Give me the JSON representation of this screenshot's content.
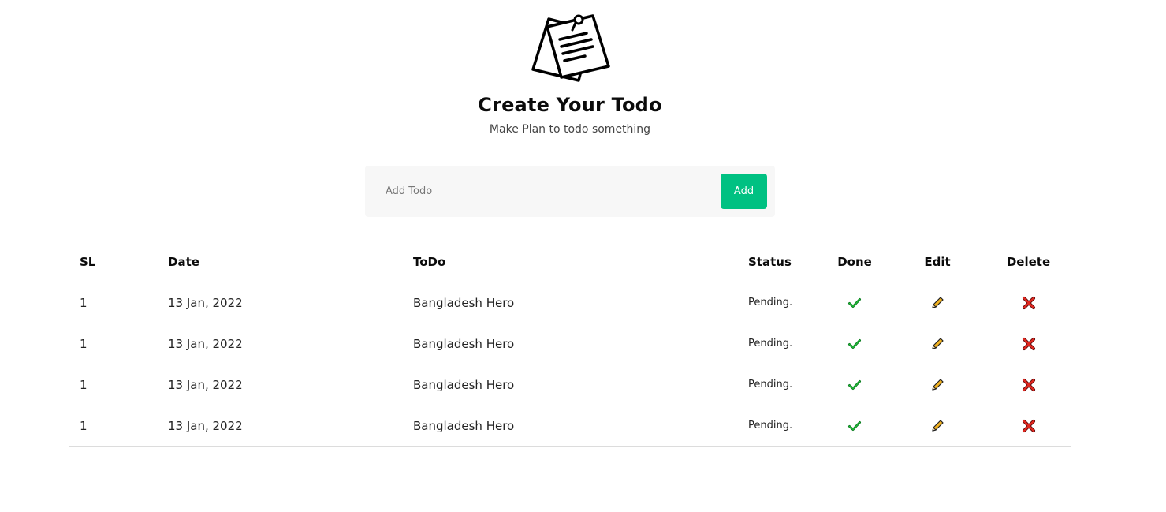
{
  "header": {
    "title": "Create Your Todo",
    "subtitle": "Make Plan to todo something",
    "icon": "sticky-notes-icon"
  },
  "add_form": {
    "placeholder": "Add Todo",
    "value": "",
    "button_label": "Add",
    "button_color": "#00c182"
  },
  "table": {
    "headers": [
      "SL",
      "Date",
      "ToDo",
      "Status",
      "Done",
      "Edit",
      "Delete"
    ],
    "rows": [
      {
        "sl": "1",
        "date": "13 Jan, 2022",
        "todo": "Bangladesh Hero",
        "status": "Pending."
      },
      {
        "sl": "1",
        "date": "13 Jan, 2022",
        "todo": "Bangladesh Hero",
        "status": "Pending."
      },
      {
        "sl": "1",
        "date": "13 Jan, 2022",
        "todo": "Bangladesh Hero",
        "status": "Pending."
      },
      {
        "sl": "1",
        "date": "13 Jan, 2022",
        "todo": "Bangladesh Hero",
        "status": "Pending."
      }
    ],
    "icons": {
      "done": "check-icon",
      "edit": "pencil-icon",
      "delete": "cross-icon"
    }
  }
}
